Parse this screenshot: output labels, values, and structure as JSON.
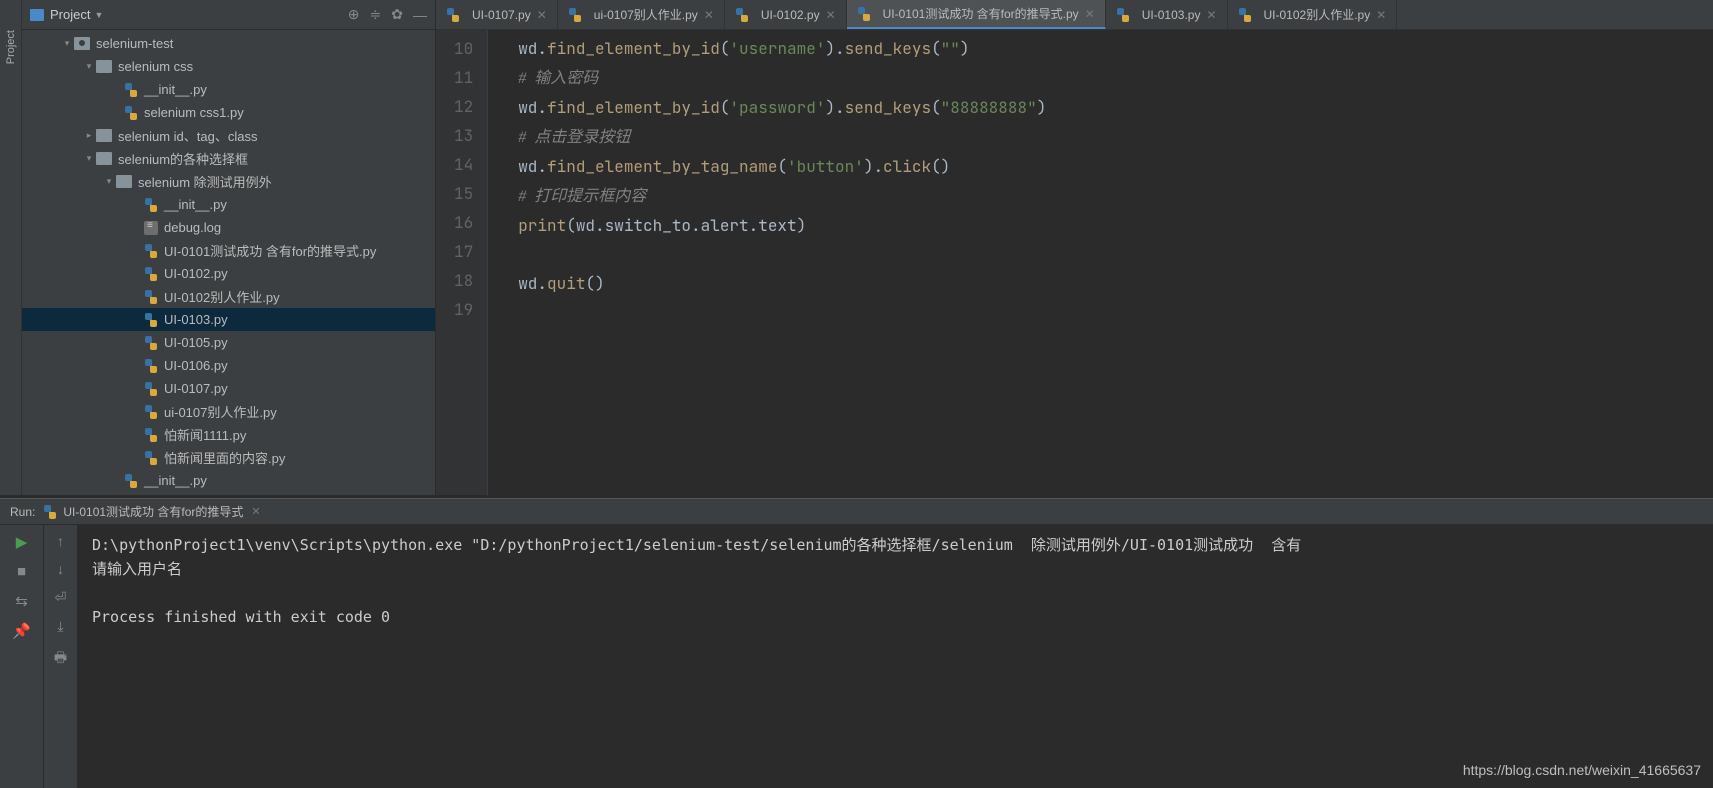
{
  "sidebar": {
    "title": "Project",
    "tree": [
      {
        "indent": 38,
        "type": "folder",
        "chev": "▾",
        "label": "selenium-test",
        "root": true
      },
      {
        "indent": 60,
        "type": "folder",
        "chev": "▾",
        "label": "selenium css"
      },
      {
        "indent": 102,
        "type": "py",
        "label": "__init__.py"
      },
      {
        "indent": 102,
        "type": "py",
        "label": "selenium css1.py"
      },
      {
        "indent": 60,
        "type": "folder",
        "chev": "▸",
        "label": "selenium id、tag、class"
      },
      {
        "indent": 60,
        "type": "folder",
        "chev": "▾",
        "label": "selenium的各种选择框"
      },
      {
        "indent": 80,
        "type": "folder",
        "chev": "▾",
        "label": "selenium  除测试用例外"
      },
      {
        "indent": 122,
        "type": "py",
        "label": "__init__.py"
      },
      {
        "indent": 122,
        "type": "log",
        "label": "debug.log"
      },
      {
        "indent": 122,
        "type": "py",
        "label": "UI-0101测试成功  含有for的推导式.py"
      },
      {
        "indent": 122,
        "type": "py",
        "label": "UI-0102.py"
      },
      {
        "indent": 122,
        "type": "py",
        "label": "UI-0102别人作业.py"
      },
      {
        "indent": 122,
        "type": "py",
        "label": "UI-0103.py",
        "selected": true
      },
      {
        "indent": 122,
        "type": "py",
        "label": "UI-0105.py"
      },
      {
        "indent": 122,
        "type": "py",
        "label": "UI-0106.py"
      },
      {
        "indent": 122,
        "type": "py",
        "label": "UI-0107.py"
      },
      {
        "indent": 122,
        "type": "py",
        "label": "ui-0107别人作业.py"
      },
      {
        "indent": 122,
        "type": "py",
        "label": "怕新闻1111.py"
      },
      {
        "indent": 122,
        "type": "py",
        "label": "怕新闻里面的内容.py"
      },
      {
        "indent": 102,
        "type": "py",
        "label": "__init__.py"
      }
    ]
  },
  "tabs": [
    {
      "label": "UI-0107.py"
    },
    {
      "label": "ui-0107别人作业.py"
    },
    {
      "label": "UI-0102.py"
    },
    {
      "label": "UI-0101测试成功  含有for的推导式.py",
      "active": true
    },
    {
      "label": "UI-0103.py"
    },
    {
      "label": "UI-0102别人作业.py"
    }
  ],
  "editor": {
    "firstLine": 10,
    "lines": [
      {
        "t": "code",
        "segs": [
          {
            "c": "",
            "t": "wd."
          },
          {
            "c": "c-func",
            "t": "find_element_by_id"
          },
          {
            "c": "",
            "t": "("
          },
          {
            "c": "c-str",
            "t": "'username'"
          },
          {
            "c": "",
            "t": ")."
          },
          {
            "c": "c-func",
            "t": "send_keys"
          },
          {
            "c": "",
            "t": "("
          },
          {
            "c": "c-str",
            "t": "\"\""
          },
          {
            "c": "",
            "t": ")"
          }
        ]
      },
      {
        "t": "cmt",
        "text": "#  输入密码"
      },
      {
        "t": "code",
        "segs": [
          {
            "c": "",
            "t": "wd."
          },
          {
            "c": "c-func",
            "t": "find_element_by_id"
          },
          {
            "c": "",
            "t": "("
          },
          {
            "c": "c-str",
            "t": "'password'"
          },
          {
            "c": "",
            "t": ")."
          },
          {
            "c": "c-func",
            "t": "send_keys"
          },
          {
            "c": "",
            "t": "("
          },
          {
            "c": "c-str",
            "t": "\"88888888\""
          },
          {
            "c": "",
            "t": ")"
          }
        ]
      },
      {
        "t": "cmt",
        "text": "#  点击登录按钮"
      },
      {
        "t": "code",
        "segs": [
          {
            "c": "",
            "t": "wd."
          },
          {
            "c": "c-func",
            "t": "find_element_by_tag_name"
          },
          {
            "c": "",
            "t": "("
          },
          {
            "c": "c-str",
            "t": "'button'"
          },
          {
            "c": "",
            "t": ")."
          },
          {
            "c": "c-func",
            "t": "click"
          },
          {
            "c": "",
            "t": "()"
          }
        ]
      },
      {
        "t": "cmt",
        "text": "#  打印提示框内容"
      },
      {
        "t": "code",
        "segs": [
          {
            "c": "c-call",
            "t": "print"
          },
          {
            "c": "",
            "t": "(wd.switch_to.alert.text)"
          }
        ]
      },
      {
        "t": "blank"
      },
      {
        "t": "code",
        "segs": [
          {
            "c": "",
            "t": "wd."
          },
          {
            "c": "c-func",
            "t": "quit"
          },
          {
            "c": "",
            "t": "()"
          }
        ]
      },
      {
        "t": "blank"
      }
    ]
  },
  "run": {
    "label": "Run:",
    "name": "UI-0101测试成功  含有for的推导式",
    "output": [
      "D:\\pythonProject1\\venv\\Scripts\\python.exe \"D:/pythonProject1/selenium-test/selenium的各种选择框/selenium  除测试用例外/UI-0101测试成功  含有",
      "请输入用户名",
      "",
      "Process finished with exit code 0"
    ]
  },
  "watermark": "https://blog.csdn.net/weixin_41665637"
}
